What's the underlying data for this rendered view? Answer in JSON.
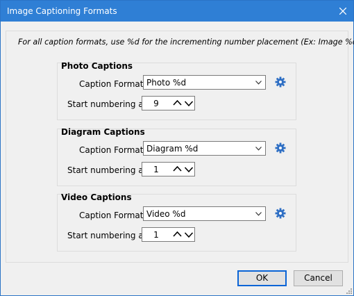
{
  "window": {
    "title": "Image Captioning Formats"
  },
  "instructions": "For all caption formats, use %d for the incrementing number placement (Ex: Image %d)",
  "sections": [
    {
      "title": "Photo Captions",
      "format_label": "Caption Format:",
      "format_value": "Photo %d",
      "start_label": "Start numbering at:",
      "start_value": "9"
    },
    {
      "title": "Diagram Captions",
      "format_label": "Caption Format:",
      "format_value": "Diagram %d",
      "start_label": "Start numbering at:",
      "start_value": "1"
    },
    {
      "title": "Video Captions",
      "format_label": "Caption Format:",
      "format_value": "Video %d",
      "start_label": "Start numbering at:",
      "start_value": "1"
    }
  ],
  "buttons": {
    "ok": "OK",
    "cancel": "Cancel"
  },
  "colors": {
    "titlebar": "#2f7fd5",
    "gear": "#2f6fc4",
    "default_button_border": "#0a64d6"
  },
  "icons": {
    "close": "close-icon",
    "gear": "gear-icon",
    "dropdown": "chevron-down-icon",
    "spin_up": "chevron-up-icon",
    "spin_down": "chevron-down-icon",
    "resize": "resize-grip-icon"
  }
}
